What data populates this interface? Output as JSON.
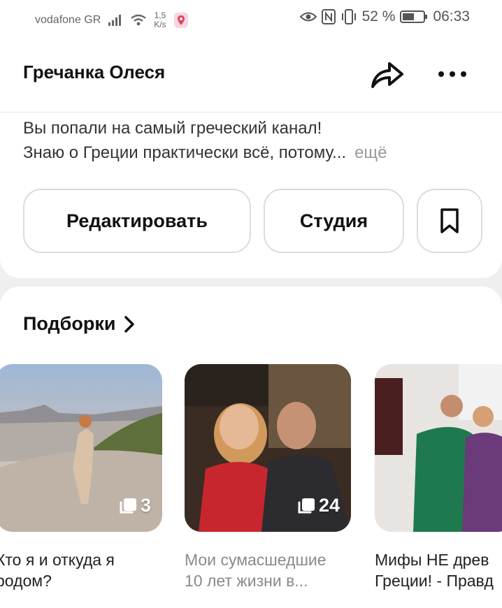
{
  "status_bar": {
    "carrier": "vodafone GR",
    "speed_value": "1,5",
    "speed_unit": "K/s",
    "battery": "52 %",
    "time": "06:33"
  },
  "header": {
    "title": "Гречанка Олеся",
    "share_icon": "share-arrow-icon",
    "more_icon": "more-dots-icon"
  },
  "description": {
    "line1": "Вы попали на самый греческий канал!",
    "line2": "Знаю о Греции практически всё, потому...",
    "more": "ещё"
  },
  "actions": {
    "edit_label": "Редактировать",
    "studio_label": "Студия",
    "bookmark_icon": "bookmark-icon"
  },
  "collections": {
    "title": "Подборки",
    "items": [
      {
        "count": "3",
        "caption_line1": "Кто я и откуда я",
        "caption_line2": "родом?"
      },
      {
        "count": "24",
        "caption_line1": "Мои сумасшедшие",
        "caption_line2": "10 лет жизни в..."
      },
      {
        "count": "",
        "caption_line1": "Мифы НЕ древ",
        "caption_line2": "Греции! - Правд"
      }
    ]
  },
  "colors": {
    "background": "#efefef",
    "card": "#ffffff",
    "text": "#111111",
    "muted": "#8a8a8a"
  }
}
